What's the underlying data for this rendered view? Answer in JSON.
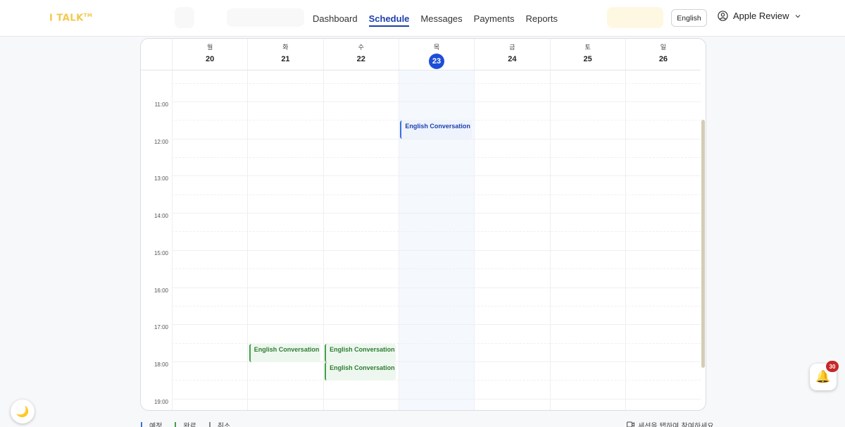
{
  "header": {
    "logo_text": "I TALK",
    "logo_mark": "TM",
    "nav": [
      {
        "label": "Dashboard",
        "active": false
      },
      {
        "label": "Schedule",
        "active": true
      },
      {
        "label": "Messages",
        "active": false
      },
      {
        "label": "Payments",
        "active": false
      },
      {
        "label": "Reports",
        "active": false
      }
    ],
    "language_button": "English",
    "user_name": "Apple Review"
  },
  "calendar": {
    "days": [
      {
        "dow": "월",
        "date": "20",
        "today": false
      },
      {
        "dow": "화",
        "date": "21",
        "today": false
      },
      {
        "dow": "수",
        "date": "22",
        "today": false
      },
      {
        "dow": "목",
        "date": "23",
        "today": true
      },
      {
        "dow": "금",
        "date": "24",
        "today": false
      },
      {
        "dow": "토",
        "date": "25",
        "today": false
      },
      {
        "dow": "일",
        "date": "26",
        "today": false
      }
    ],
    "time_labels": [
      "11:00",
      "12:00",
      "13:00",
      "14:00",
      "15:00",
      "16:00",
      "17:00",
      "18:00",
      "19:00"
    ],
    "events": [
      {
        "title": "English Conversation",
        "day": 3,
        "start": "11:30",
        "status": "scheduled"
      },
      {
        "title": "English Conversation",
        "day": 1,
        "start": "17:30",
        "status": "completed"
      },
      {
        "title": "English Conversation",
        "day": 2,
        "start": "17:30",
        "status": "completed"
      },
      {
        "title": "English Conversation",
        "day": 2,
        "start": "18:00",
        "status": "completed"
      }
    ]
  },
  "legend": [
    {
      "label": "예정",
      "color": "#3b6fe0"
    },
    {
      "label": "완료",
      "color": "#43a047"
    },
    {
      "label": "취소",
      "color": "#888888"
    }
  ],
  "hint": "세션을 탭하여 참여하세요",
  "notification_count": "30",
  "colors": {
    "accent": "#1d4ed8",
    "logo": "#f2c94c",
    "badge": "#c62828"
  }
}
